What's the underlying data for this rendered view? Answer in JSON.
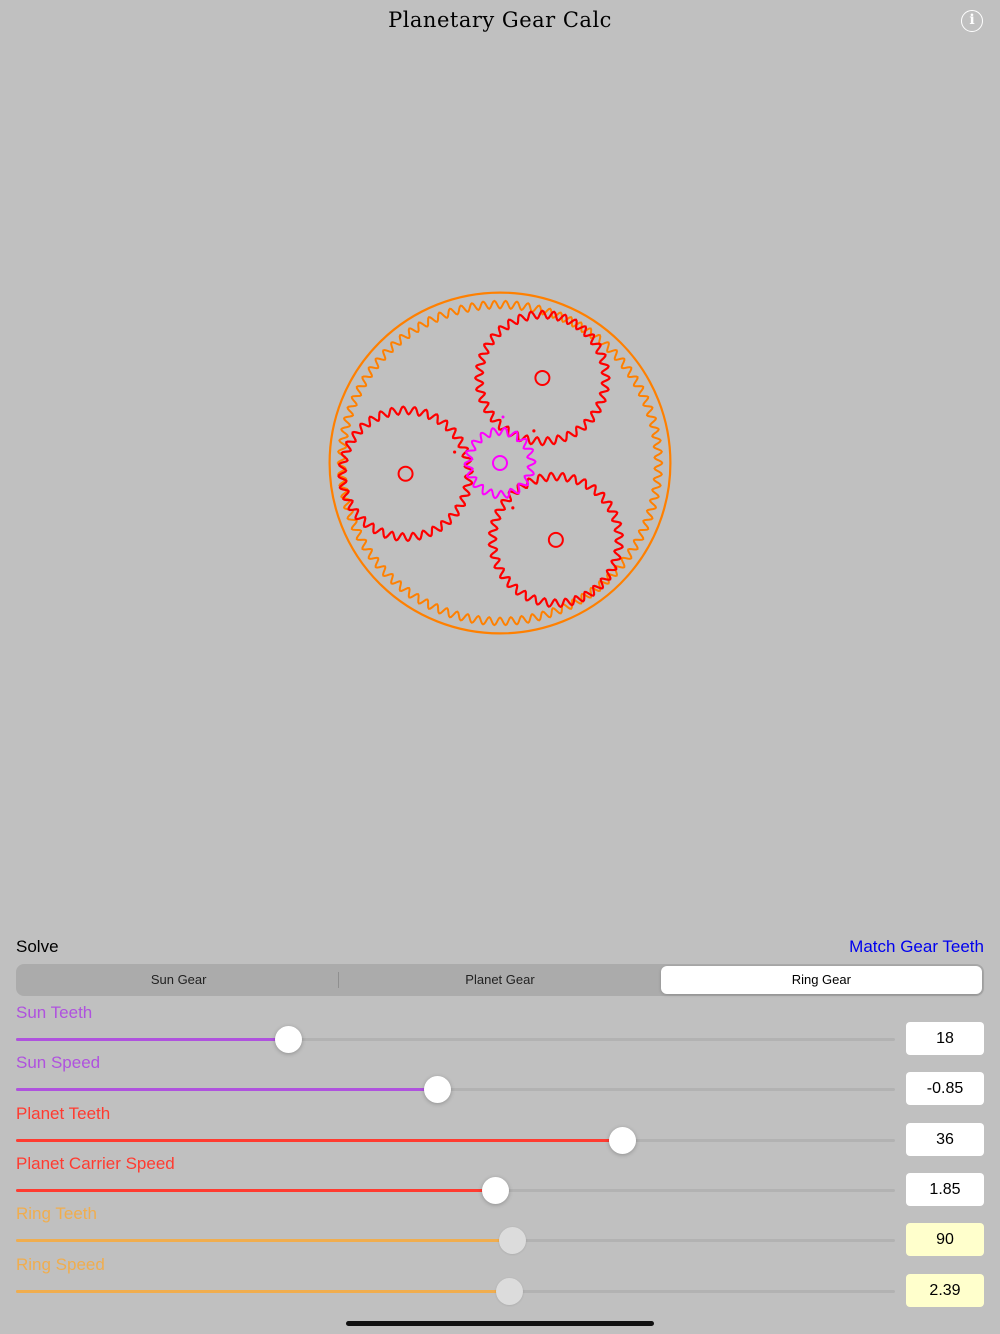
{
  "app": {
    "title": "Planetary Gear Calc",
    "info_icon": "info-icon",
    "info_glyph": "i"
  },
  "colors": {
    "background": "#c0c0c0",
    "sun": "#ff00ff",
    "planet": "#ff0000",
    "ring": "#ff8000",
    "sun_slider": "#af52de",
    "planet_slider": "#ff3b30",
    "ring_slider": "#f0ad4e",
    "link": "#0000ee"
  },
  "diagram": {
    "sun_teeth": 18,
    "planet_teeth": 36,
    "ring_teeth": 90,
    "planet_count": 3
  },
  "controls": {
    "solve_label": "Solve",
    "match_link": "Match Gear Teeth",
    "segments": [
      "Sun Gear",
      "Planet Gear",
      "Ring Gear"
    ],
    "selected_segment": "Ring Gear",
    "sliders": [
      {
        "label": "Sun Teeth",
        "value": "18",
        "level": 0.31,
        "color": "sun_slider",
        "enabled": true
      },
      {
        "label": "Sun Speed",
        "value": "-0.85",
        "level": 0.48,
        "color": "sun_slider",
        "enabled": true
      },
      {
        "label": "Planet Teeth",
        "value": "36",
        "level": 0.69,
        "color": "planet_slider",
        "enabled": true
      },
      {
        "label": "Planet Carrier Speed",
        "value": "1.85",
        "level": 0.545,
        "color": "planet_slider",
        "enabled": true
      },
      {
        "label": "Ring Teeth",
        "value": "90",
        "level": 0.565,
        "color": "ring_slider",
        "enabled": false
      },
      {
        "label": "Ring Speed",
        "value": "2.39",
        "level": 0.561,
        "color": "ring_slider",
        "enabled": false
      }
    ]
  }
}
